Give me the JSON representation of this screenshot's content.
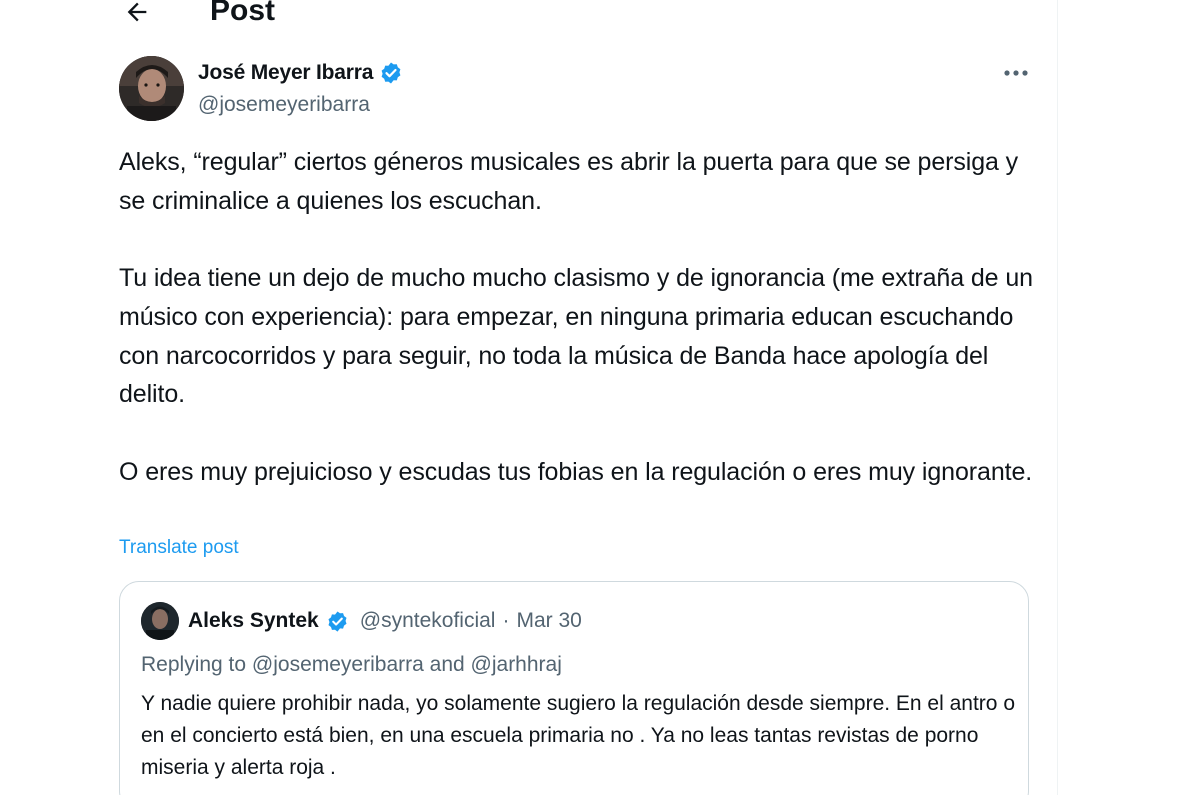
{
  "header": {
    "title": "Post",
    "back_icon": "arrow-left-icon"
  },
  "post": {
    "author_name": "José Meyer Ibarra",
    "author_handle": "@josemeyeribarra",
    "verified_icon": "verified-badge-icon",
    "more_icon": "more-horizontal-icon",
    "paragraphs": [
      "Aleks, “regular” ciertos géneros musicales es abrir la puerta para que se persiga y se criminalice a quienes los escuchan.",
      "Tu idea tiene un dejo de mucho mucho clasismo y de ignorancia (me extraña de un músico con experiencia): para empezar, en ninguna primaria educan escuchando con narcocorridos y para seguir, no toda la música de Banda hace apología del delito.",
      "O eres muy prejuicioso y escudas tus fobias en la regulación o eres muy ignorante."
    ],
    "translate_label": "Translate post"
  },
  "quote": {
    "author_name": "Aleks Syntek",
    "author_handle": "@syntekoficial",
    "separator": "·",
    "date": "Mar 30",
    "replying_prefix": "Replying to",
    "replying_user1": "@josemeyeribarra",
    "replying_and": "and",
    "replying_user2": "@jarhhraj",
    "text": "Y nadie quiere prohibir nada, yo solamente sugiero la regulación desde siempre. En el antro o en el concierto está bien, en una escuela primaria no . Ya no leas tantas revistas de porno miseria y alerta roja ."
  },
  "colors": {
    "text": "#0f1419",
    "secondary": "#536471",
    "link": "#1d9bf0",
    "verified": "#1d9bf0",
    "border": "#cfd9de"
  }
}
